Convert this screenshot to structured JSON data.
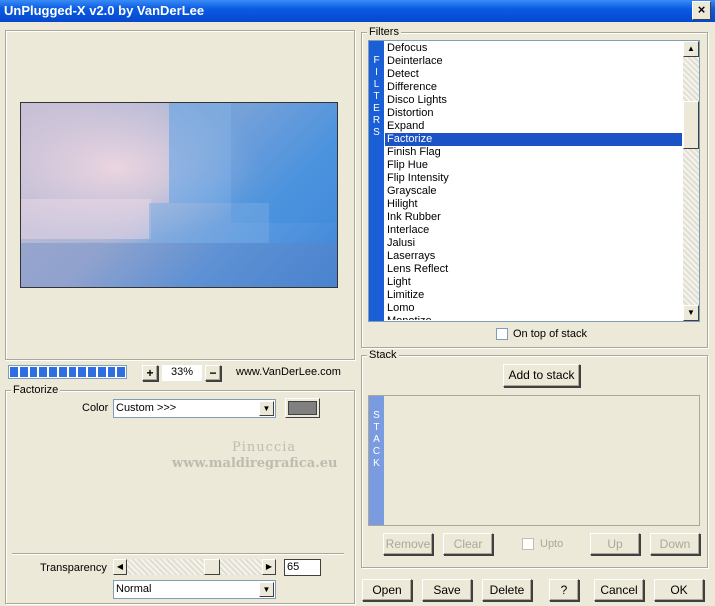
{
  "window": {
    "title": "UnPlugged-X v2.0 by VanDerLee",
    "close_glyph": "×"
  },
  "preview": {
    "zoom": "33%",
    "zoom_plus": "+",
    "zoom_minus": "−",
    "website": "www.VanDerLee.com",
    "progress_segments": 12
  },
  "filters": {
    "group_label": "Filters",
    "strip_letters": [
      "F",
      "I",
      "L",
      "T",
      "E",
      "R",
      "S"
    ],
    "items": [
      "Defocus",
      "Deinterlace",
      "Detect",
      "Difference",
      "Disco Lights",
      "Distortion",
      "Expand",
      "Factorize",
      "Finish Flag",
      "Flip Hue",
      "Flip Intensity",
      "Grayscale",
      "Hilight",
      "Ink Rubber",
      "Interlace",
      "Jalusi",
      "Laserrays",
      "Lens Reflect",
      "Light",
      "Limitize",
      "Lomo",
      "Monotize"
    ],
    "selected": "Factorize",
    "on_top_label": "On top of stack"
  },
  "settings": {
    "group_label": "Factorize",
    "color_label": "Color",
    "color_value": "Custom >>>",
    "swatch_color": "#808080",
    "watermark_line1": "Pinuccia",
    "watermark_line2": "www.maldiregrafica.eu",
    "transparency_label": "Transparency",
    "transparency_value": "65",
    "transparency_fraction": 0.65,
    "blend_value": "Normal"
  },
  "stack": {
    "group_label": "Stack",
    "add_label": "Add to stack",
    "strip_letters": [
      "S",
      "T",
      "A",
      "C",
      "K"
    ],
    "remove_label": "Remove",
    "clear_label": "Clear",
    "upto_label": "Upto",
    "up_label": "Up",
    "down_label": "Down"
  },
  "footer": {
    "open": "Open",
    "save": "Save",
    "delete": "Delete",
    "help": "?",
    "cancel": "Cancel",
    "ok": "OK"
  }
}
